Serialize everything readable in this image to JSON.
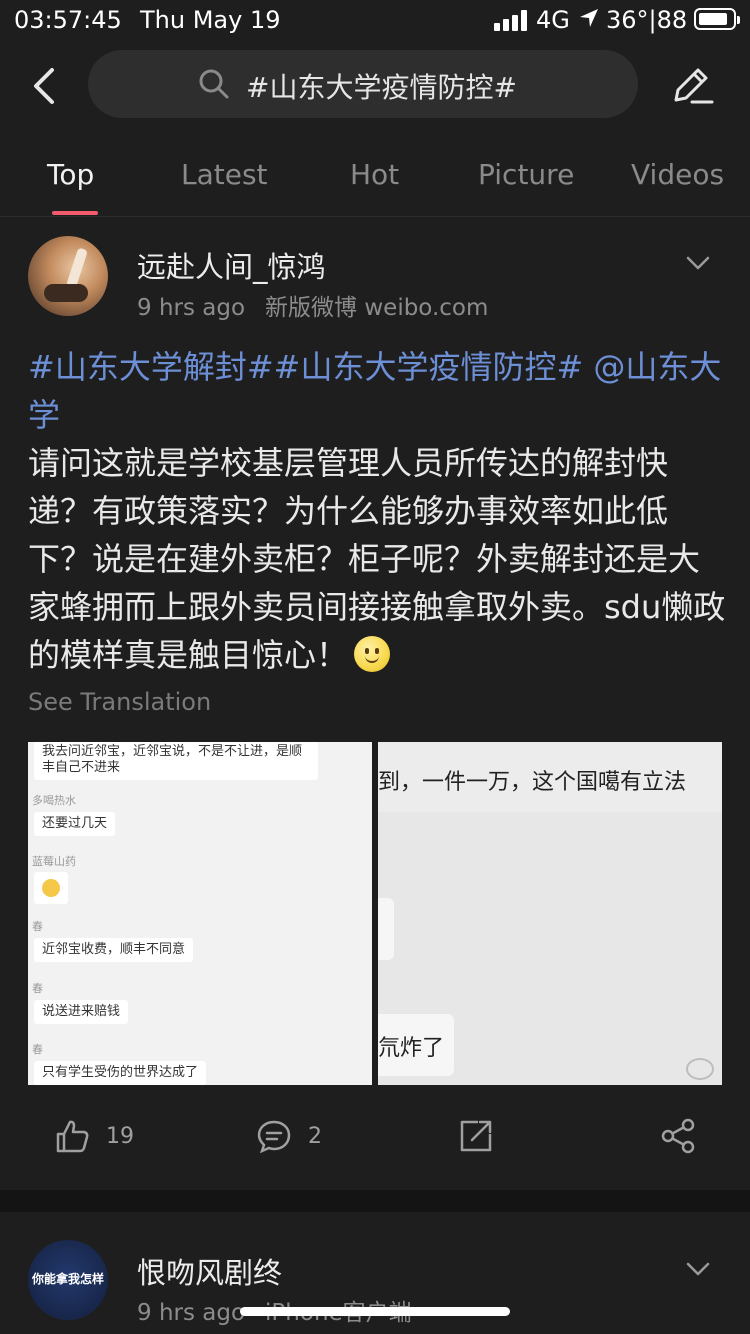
{
  "status": {
    "time": "03:57:45",
    "date": "Thu May 19",
    "network": "4G",
    "temp_battery": "36°|88"
  },
  "header": {
    "search_query": "#山东大学疫情防控#"
  },
  "tabs": [
    "Top",
    "Latest",
    "Hot",
    "Picture",
    "Videos"
  ],
  "post": {
    "username": "远赴人间_惊鸿",
    "time_ago": "9 hrs ago",
    "source": "新版微博 weibo.com",
    "tags": "#山东大学解封##山东大学疫情防控# @山东大学",
    "body": "请问这就是学校基层管理人员所传达的解封快递？有政策落实？为什么能够办事效率如此低下？说是在建外卖柜？柜子呢？外卖解封还是大家蜂拥而上跟外卖员间接接触拿取外卖。sdu懒政的模样真是触目惊心！",
    "see_translation": "See Translation",
    "image1": {
      "b1": "我去问近邻宝，近邻宝说，不是不让进，是顺丰自己不进来",
      "n1": "多喝热水",
      "b2": "还要过几天",
      "n2": "蓝莓山药",
      "n3": "春",
      "b3": "近邻宝收费，顺丰不同意",
      "n4": "春",
      "b4": "说送进来赔钱",
      "n5": "春",
      "b5": "只有学生受伤的世界达成了"
    },
    "image2": {
      "line1": "到，一件一万，这个国噶有立法",
      "frag": "氘炸了"
    },
    "likes": "19",
    "comments": "2"
  },
  "post2": {
    "username": "恨吻风剧终",
    "avatar_text": "你能拿我怎样",
    "time_ago": "9 hrs ago",
    "source": "iPhone客户端"
  }
}
